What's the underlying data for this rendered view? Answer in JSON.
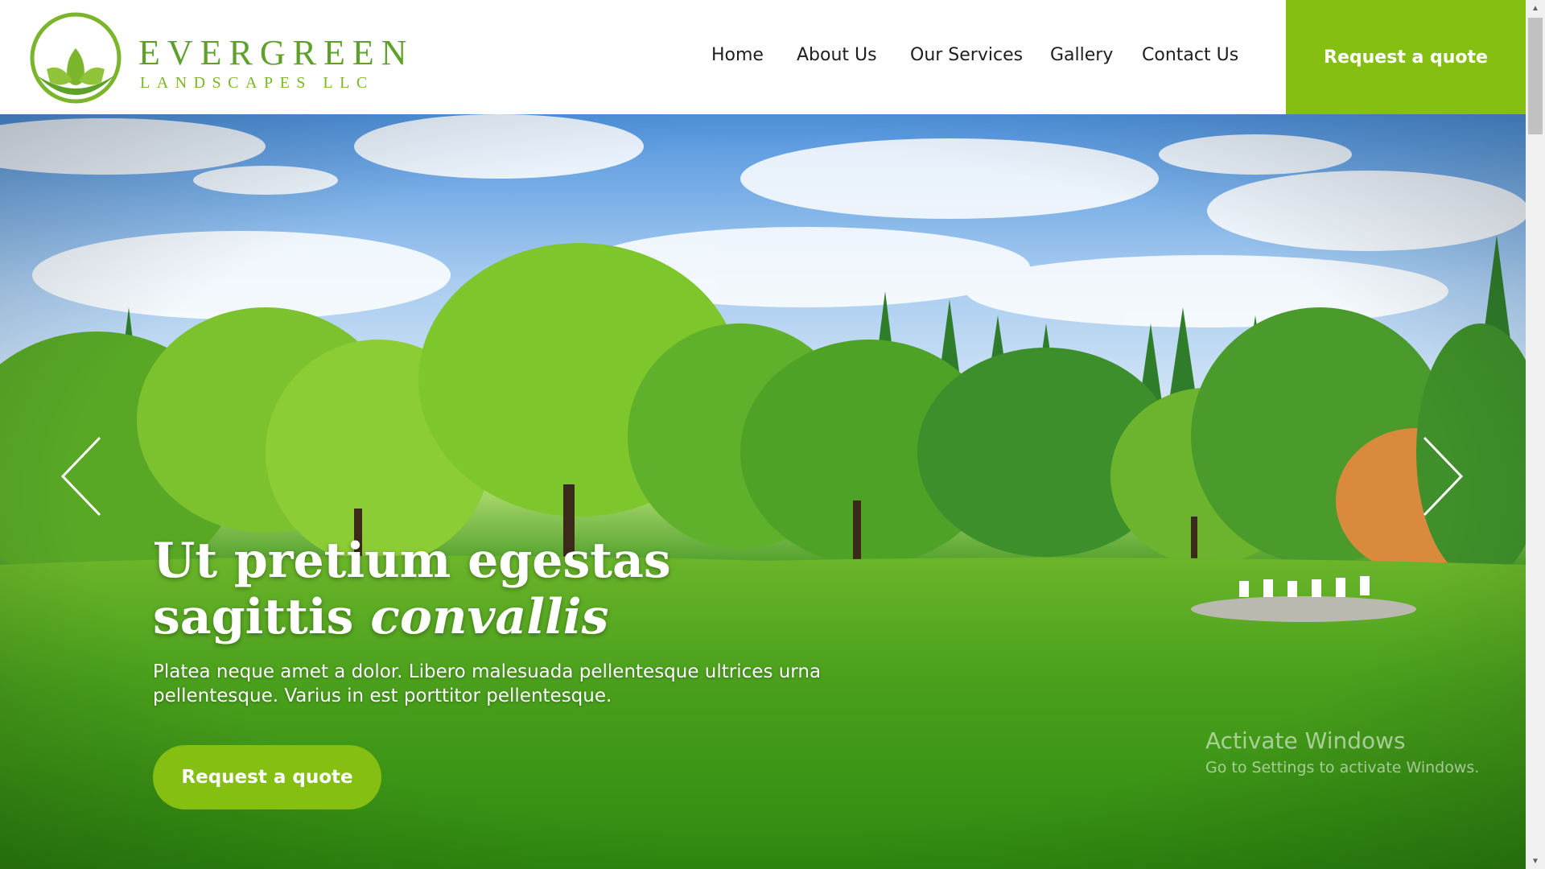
{
  "brand": {
    "name": "EVERGREEN",
    "tagline": "LANDSCAPES LLC"
  },
  "nav": {
    "items": [
      {
        "label": "Home"
      },
      {
        "label": "About Us"
      },
      {
        "label": "Our Services"
      },
      {
        "label": "Gallery"
      },
      {
        "label": "Contact Us"
      }
    ],
    "cta_label": "Request a quote"
  },
  "hero": {
    "title_line1": "Ut pretium egestas",
    "title_line2_plain": "sagittis ",
    "title_line2_italic": "convallis",
    "text": "Platea neque amet a dolor. Libero malesuada pellentesque ultrices urna pellentesque. Varius in est porttitor pellentesque.",
    "cta_label": "Request a quote",
    "prev_icon": "chevron-left-icon",
    "next_icon": "chevron-right-icon"
  },
  "watermark": {
    "title": "Activate Windows",
    "subtitle": "Go to Settings to activate Windows."
  },
  "colors": {
    "accent": "#84bf12",
    "brand_green": "#5fa02a",
    "nav_text": "#1e1e1e"
  }
}
